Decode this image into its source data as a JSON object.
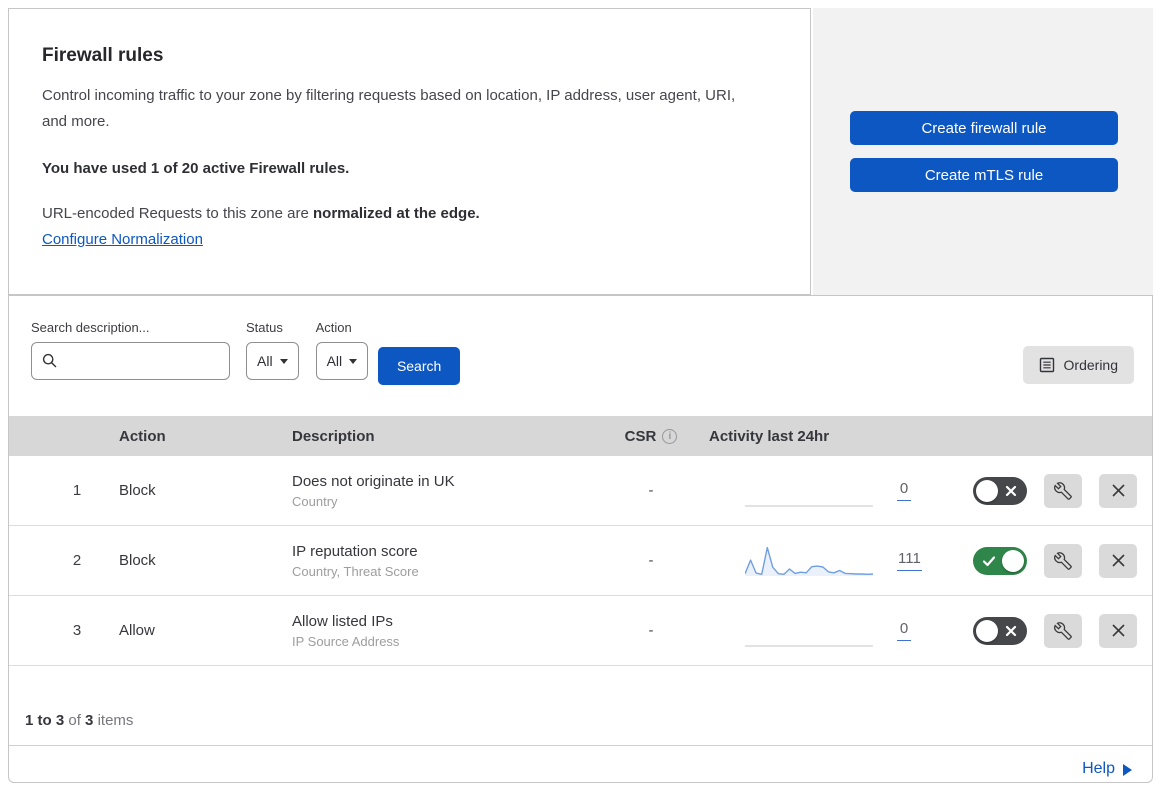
{
  "intro": {
    "title": "Firewall rules",
    "description": "Control incoming traffic to your zone by filtering requests based on location, IP address, user agent, URI, and more.",
    "usage": "You have used 1 of 20 active Firewall rules.",
    "normalization_prefix": "URL-encoded Requests to this zone are ",
    "normalization_bold": "normalized at the edge.",
    "normalization_link": "Configure Normalization"
  },
  "actions_panel": {
    "create_firewall_rule": "Create firewall rule",
    "create_mtls_rule": "Create mTLS rule"
  },
  "filters": {
    "search_label": "Search description...",
    "search_value": "",
    "status_label": "Status",
    "status_value": "All",
    "action_label": "Action",
    "action_value": "All",
    "search_button": "Search",
    "ordering_button": "Ordering"
  },
  "table": {
    "headers": {
      "action": "Action",
      "description": "Description",
      "csr": "CSR",
      "activity": "Activity last 24hr"
    },
    "rows": [
      {
        "index": "1",
        "action": "Block",
        "description": "Does not originate in UK",
        "fields": "Country",
        "csr": "-",
        "count": "0",
        "enabled": false,
        "sparkline": []
      },
      {
        "index": "2",
        "action": "Block",
        "description": "IP reputation score",
        "fields": "Country, Threat Score",
        "csr": "-",
        "count": "111",
        "enabled": true,
        "sparkline": [
          8,
          55,
          10,
          6,
          98,
          30,
          8,
          6,
          24,
          9,
          13,
          11,
          32,
          34,
          31,
          14,
          11,
          19,
          9,
          8,
          7,
          7,
          6,
          7
        ]
      },
      {
        "index": "3",
        "action": "Allow",
        "description": "Allow listed IPs",
        "fields": "IP Source Address",
        "csr": "-",
        "count": "0",
        "enabled": false,
        "sparkline": []
      }
    ]
  },
  "footer": {
    "range_bold": "1 to 3",
    "of_text": "of",
    "total_bold": "3",
    "items_text": "items",
    "help_link": "Help"
  },
  "icons": {
    "search": "magnifier",
    "caret_down": "triangle-down",
    "ordering": "list-box",
    "info": "i",
    "toggle_off_glyph": "cross",
    "toggle_on_glyph": "check",
    "wrench": "wrench",
    "close": "cross",
    "help_arrow": "triangle-right"
  },
  "colors": {
    "accent_blue": "#0d57c2",
    "toggle_on_green": "#2f864a",
    "toggle_off_gray": "#46474b",
    "sparkline_blue": "#6f9fe3",
    "header_gray": "#d7d7d7",
    "panel_gray": "#f2f2f2"
  }
}
